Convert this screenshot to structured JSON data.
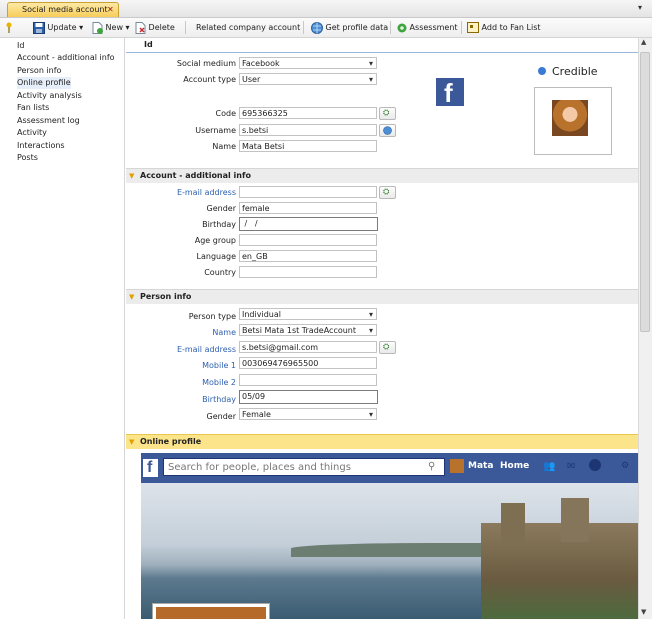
{
  "tab": {
    "title": "Social media account",
    "close": "✕"
  },
  "toolbar": {
    "update": "Update",
    "new": "New",
    "delete": "Delete",
    "related": "Related company account",
    "get_profile": "Get profile data",
    "assessment": "Assessment",
    "add_fan": "Add to Fan List"
  },
  "sidebar": {
    "items": [
      "Id",
      "Account - additional info",
      "Person info",
      "Online profile",
      "Activity analysis",
      "Fan lists",
      "Assessment log",
      "Activity",
      "Interactions",
      "Posts"
    ],
    "selected": "Online profile"
  },
  "id_section": {
    "header": "Id",
    "social_medium_label": "Social medium",
    "social_medium": "Facebook",
    "account_type_label": "Account type",
    "account_type": "User",
    "code_label": "Code",
    "code": "695366325",
    "username_label": "Username",
    "username": "s.betsi",
    "name_label": "Name",
    "name": "Mata Betsi",
    "credible": "Credible"
  },
  "account_section": {
    "header": "Account - additional info",
    "email_label": "E-mail address",
    "email": "",
    "gender_label": "Gender",
    "gender": "female",
    "birthday_label": "Birthday",
    "birthday": " /   /",
    "age_group_label": "Age group",
    "age_group": "",
    "language_label": "Language",
    "language": "en_GB",
    "country_label": "Country",
    "country": ""
  },
  "person_section": {
    "header": "Person info",
    "person_type_label": "Person type",
    "person_type": "Individual",
    "name_label": "Name",
    "name": "Betsi Mata 1st TradeAccount",
    "email_label": "E-mail address",
    "email": "s.betsi@gmail.com",
    "mobile1_label": "Mobile 1",
    "mobile1": "003069476965500",
    "mobile2_label": "Mobile 2",
    "mobile2": "",
    "birthday_label": "Birthday",
    "birthday": "05/09",
    "gender_label": "Gender",
    "gender": "Female"
  },
  "online_section": {
    "header": "Online profile",
    "fb_search_placeholder": "Search for people, places and things",
    "fb_user": "Mata",
    "fb_home": "Home"
  },
  "colors": {
    "accent": "#f7cd5a",
    "fb_blue": "#3b5998",
    "link_blue": "#2e5fb0"
  }
}
